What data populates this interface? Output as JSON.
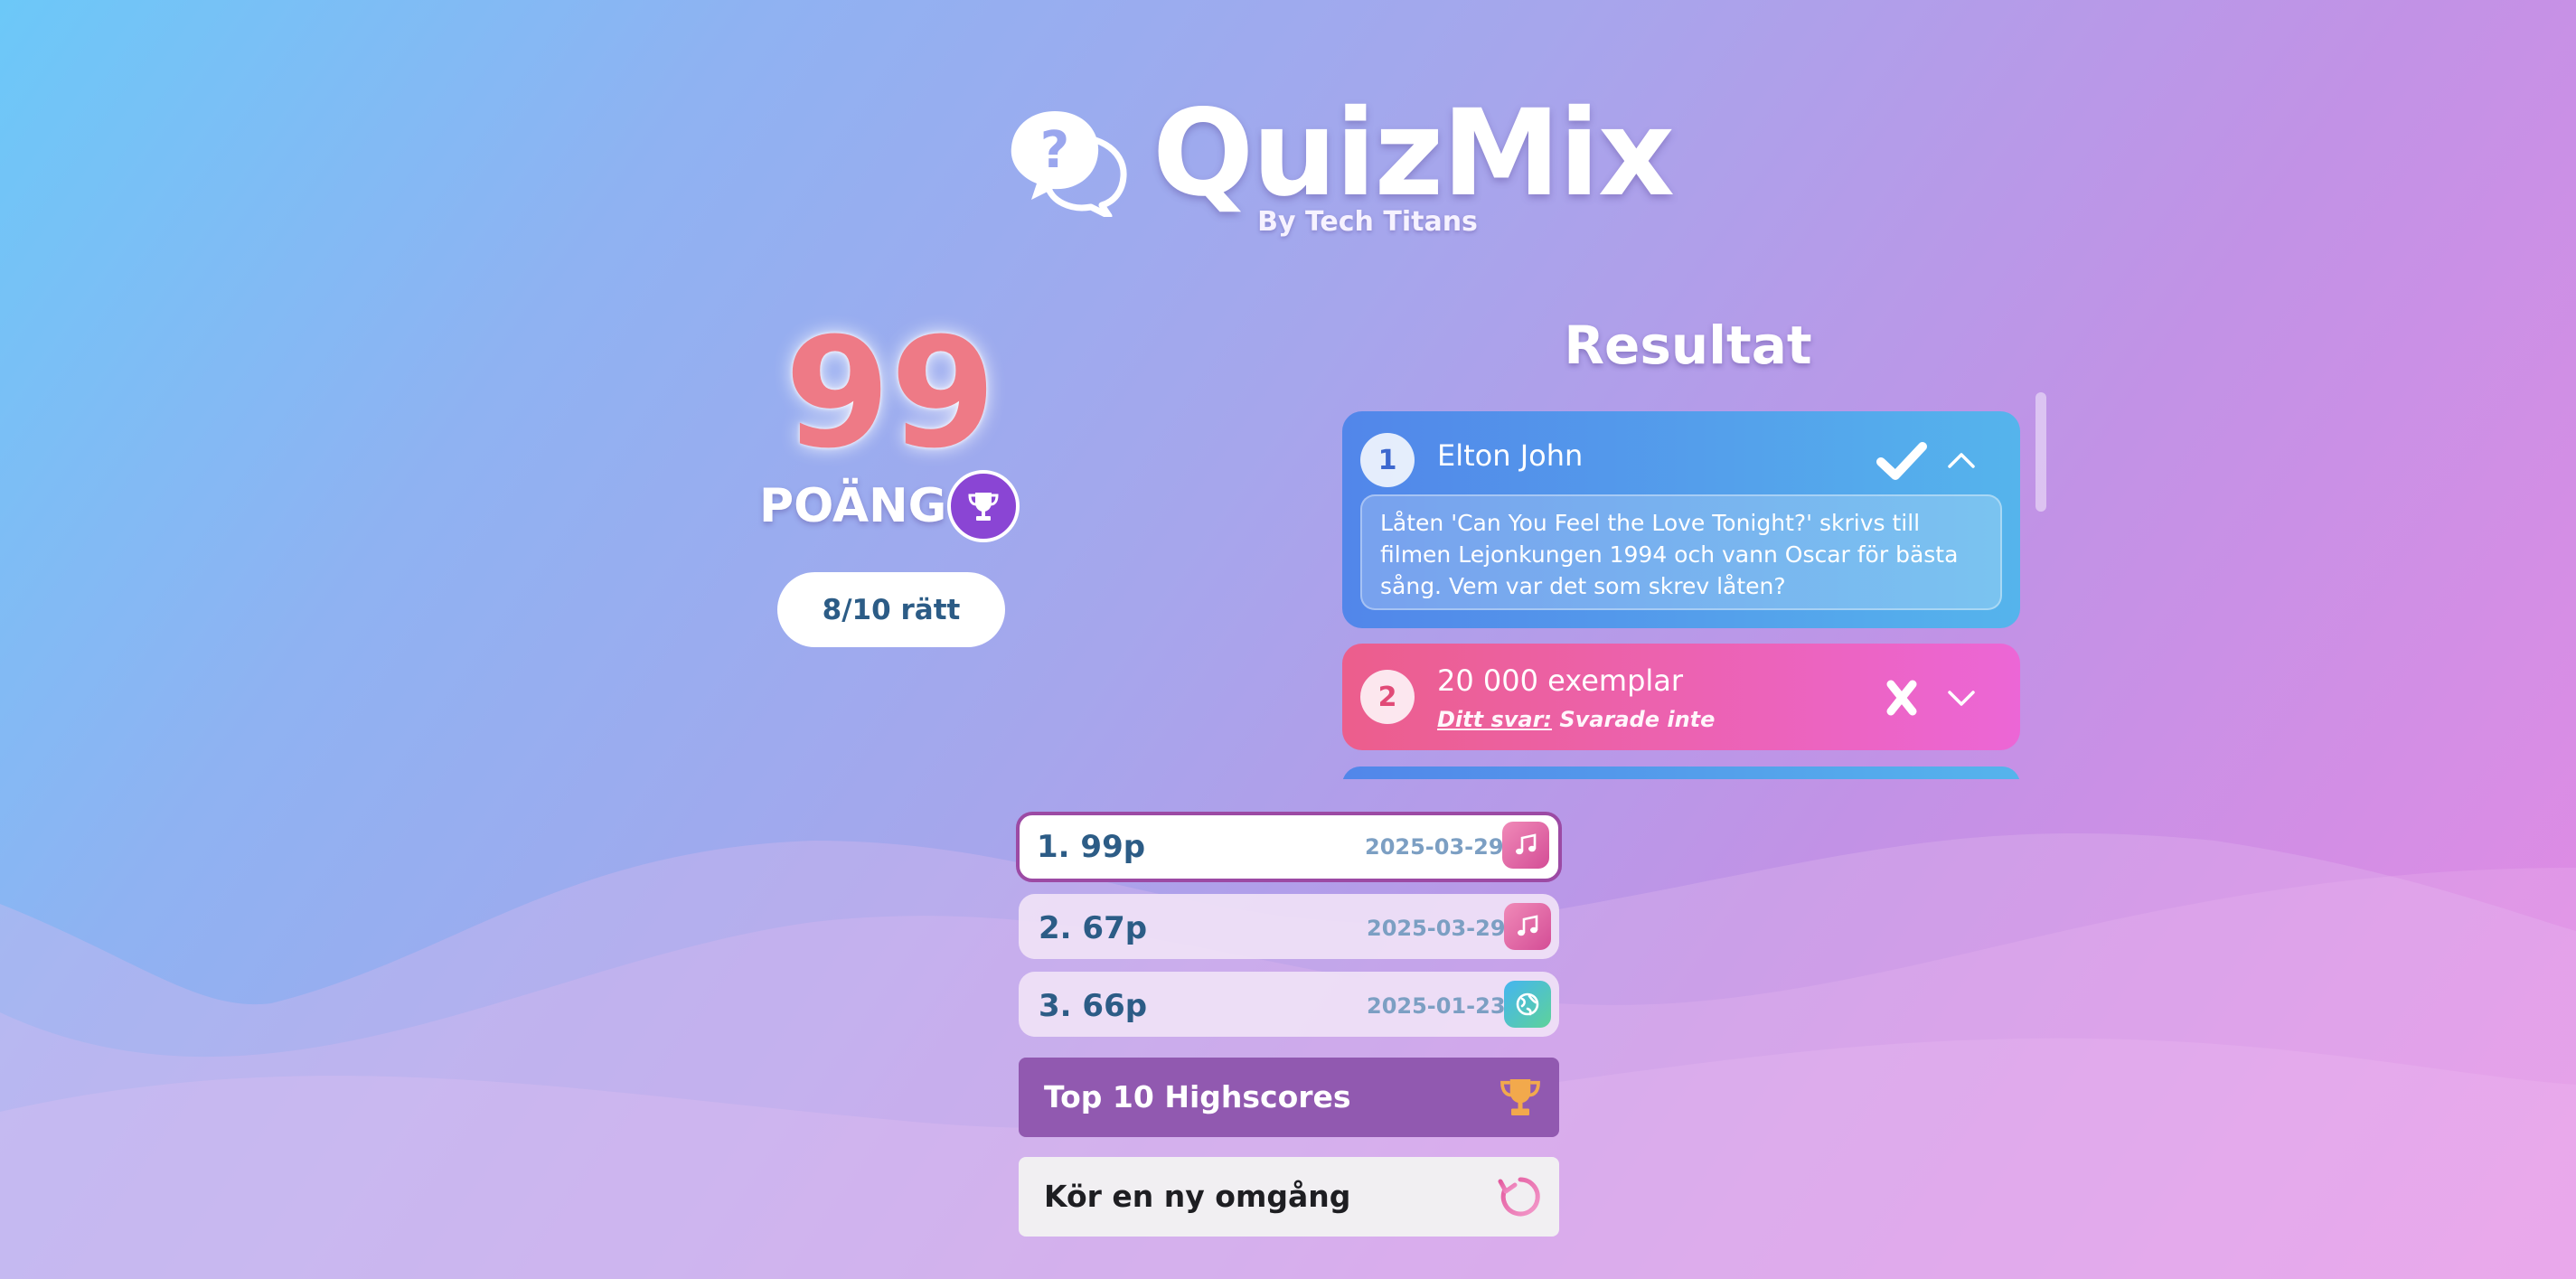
{
  "header": {
    "brand": "QuizMix",
    "byline": "By Tech Titans"
  },
  "score": {
    "points": "99",
    "label": "POÄNG",
    "correct": "8/10 rätt"
  },
  "results": {
    "title": "Resultat",
    "items": [
      {
        "number": "1",
        "answer": "Elton John",
        "status": "correct",
        "expanded": true,
        "question": "Låten 'Can You Feel the Love Tonight?' skrivs till filmen Lejonkungen 1994 och vann Oscar för bästa sång. Vem var det som skrev låten?"
      },
      {
        "number": "2",
        "answer": "20 000 exemplar",
        "status": "wrong",
        "expanded": false,
        "your_answer_label": "Ditt svar:",
        "your_answer_value": "Svarade inte"
      }
    ]
  },
  "highscores": [
    {
      "rank": "1. 99p",
      "date": "2025-03-29",
      "category_icon": "music-note-icon",
      "current": true
    },
    {
      "rank": "2. 67p",
      "date": "2025-03-29",
      "category_icon": "music-note-icon",
      "current": false
    },
    {
      "rank": "3. 66p",
      "date": "2025-01-23",
      "category_icon": "globe-icon",
      "current": false
    }
  ],
  "buttons": {
    "top10_label": "Top 10 Highscores",
    "new_round_label": "Kör en ny omgång"
  },
  "colors": {
    "brand_purple": "#8a45d4",
    "correct_card": "#5286ea",
    "wrong_card": "#ec5e8c",
    "highscore_button": "#9159b0"
  }
}
